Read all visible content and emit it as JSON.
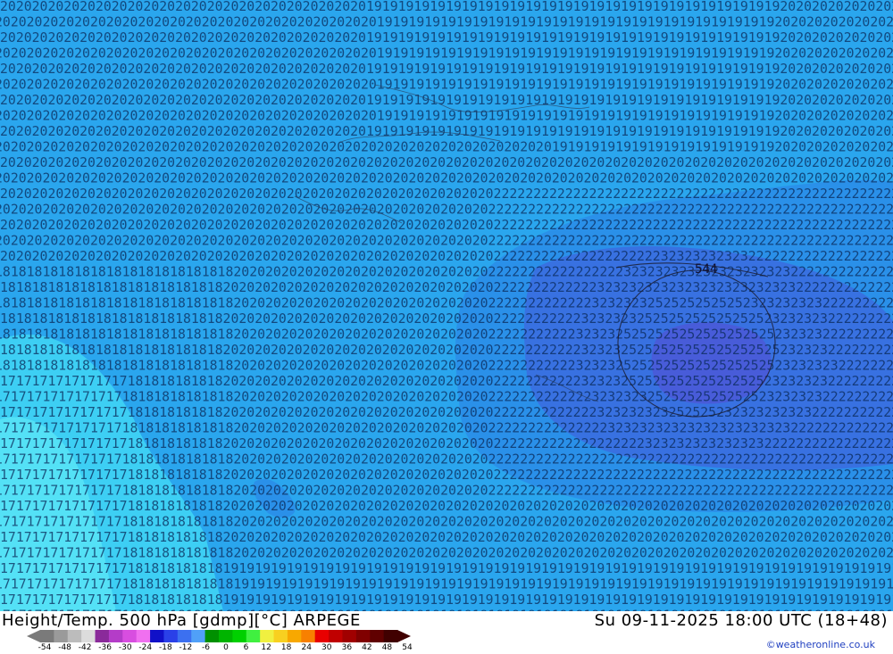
{
  "title": {
    "left": "Height/Temp. 500 hPa [gdmp][°C] ARPEGE",
    "right": "Su 09-11-2025 18:00 UTC (18+48)"
  },
  "credit": "©weatheronline.co.uk",
  "legend": {
    "labels": [
      "-54",
      "-48",
      "-42",
      "-36",
      "-30",
      "-24",
      "-18",
      "-12",
      "-6",
      "0",
      "6",
      "12",
      "18",
      "24",
      "30",
      "36",
      "42",
      "48",
      "54"
    ],
    "colors": [
      "#7a7a7a",
      "#9a9a9a",
      "#bcbcbc",
      "#dcdcdc",
      "#8a2a9a",
      "#b43cc8",
      "#d84ee0",
      "#f070f0",
      "#1010c8",
      "#2a40e8",
      "#3c70f0",
      "#50a0f8",
      "#009000",
      "#00b400",
      "#00d000",
      "#40f040",
      "#f0f040",
      "#f8d020",
      "#f8a800",
      "#f88000",
      "#e80000",
      "#c00000",
      "#a00000",
      "#800000",
      "#600000",
      "#400000"
    ]
  },
  "map": {
    "contour_label": "544",
    "field_colors": {
      "base": "#2aa6ee",
      "light_cyan": "#3fd4f4",
      "cyan": "#22c6f0",
      "mid_blue": "#2a8ee8",
      "blue": "#3a6ee0",
      "deep_blue": "#4a5ad8"
    }
  }
}
